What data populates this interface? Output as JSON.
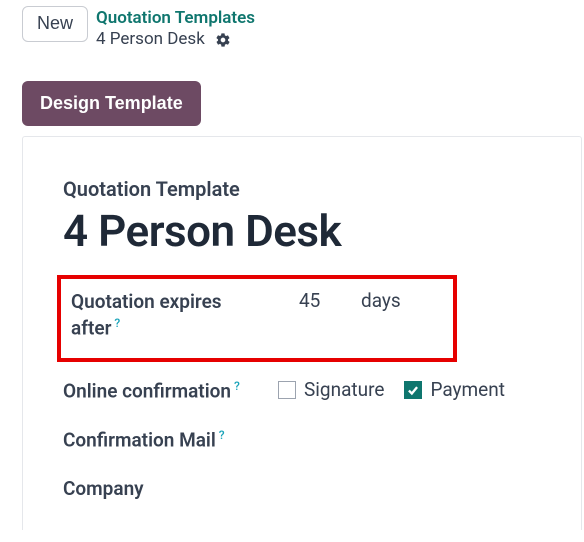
{
  "topbar": {
    "new_label": "New",
    "breadcrumb_parent": "Quotation Templates",
    "breadcrumb_current": "4 Person Desk"
  },
  "actions": {
    "design_template_label": "Design Template"
  },
  "form": {
    "section_label": "Quotation Template",
    "title": "4 Person Desk",
    "fields": {
      "expires": {
        "label": "Quotation expires after",
        "value": "45",
        "unit": "days"
      },
      "online_confirmation": {
        "label": "Online confirmation",
        "signature_label": "Signature",
        "signature_checked": false,
        "payment_label": "Payment",
        "payment_checked": true
      },
      "confirmation_mail": {
        "label": "Confirmation Mail"
      },
      "company": {
        "label": "Company"
      }
    }
  }
}
